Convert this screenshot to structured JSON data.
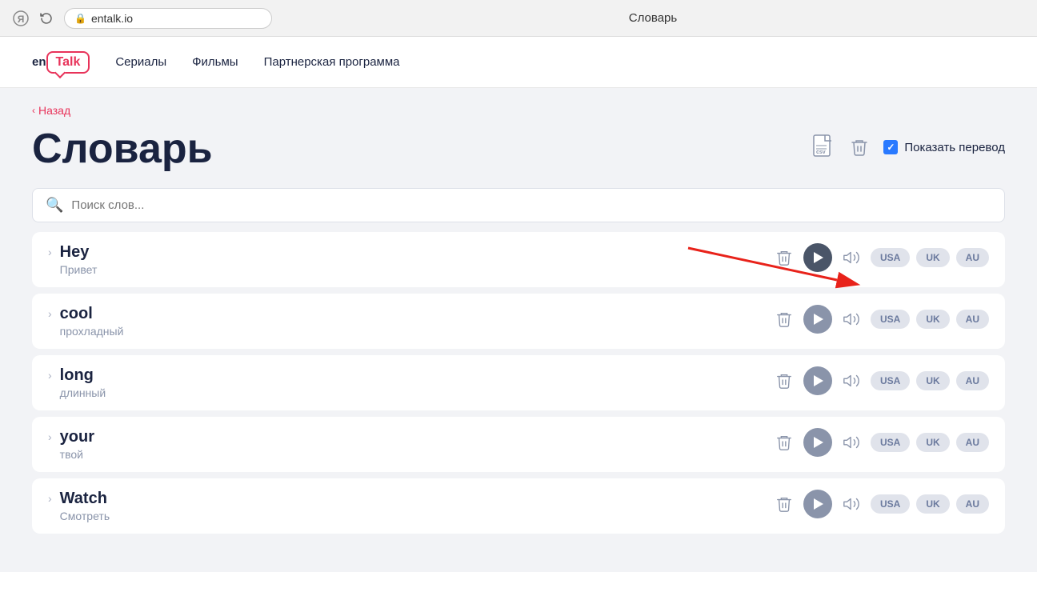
{
  "browser": {
    "url": "entalk.io",
    "title": "Словарь"
  },
  "header": {
    "logo_en": "en",
    "logo_talk": "Talk",
    "nav": [
      {
        "label": "Сериалы"
      },
      {
        "label": "Фильмы"
      },
      {
        "label": "Партнерская программа"
      }
    ]
  },
  "main": {
    "back_label": "Назад",
    "page_title": "Словарь",
    "search_placeholder": "Поиск слов...",
    "show_translation_label": "Показать перевод",
    "words": [
      {
        "en": "Hey",
        "ru": "Привет"
      },
      {
        "en": "cool",
        "ru": "прохладный"
      },
      {
        "en": "long",
        "ru": "длинный"
      },
      {
        "en": "your",
        "ru": "твой"
      },
      {
        "en": "Watch",
        "ru": "Смотреть"
      }
    ],
    "dialects": [
      "USA",
      "UK",
      "AU"
    ]
  }
}
